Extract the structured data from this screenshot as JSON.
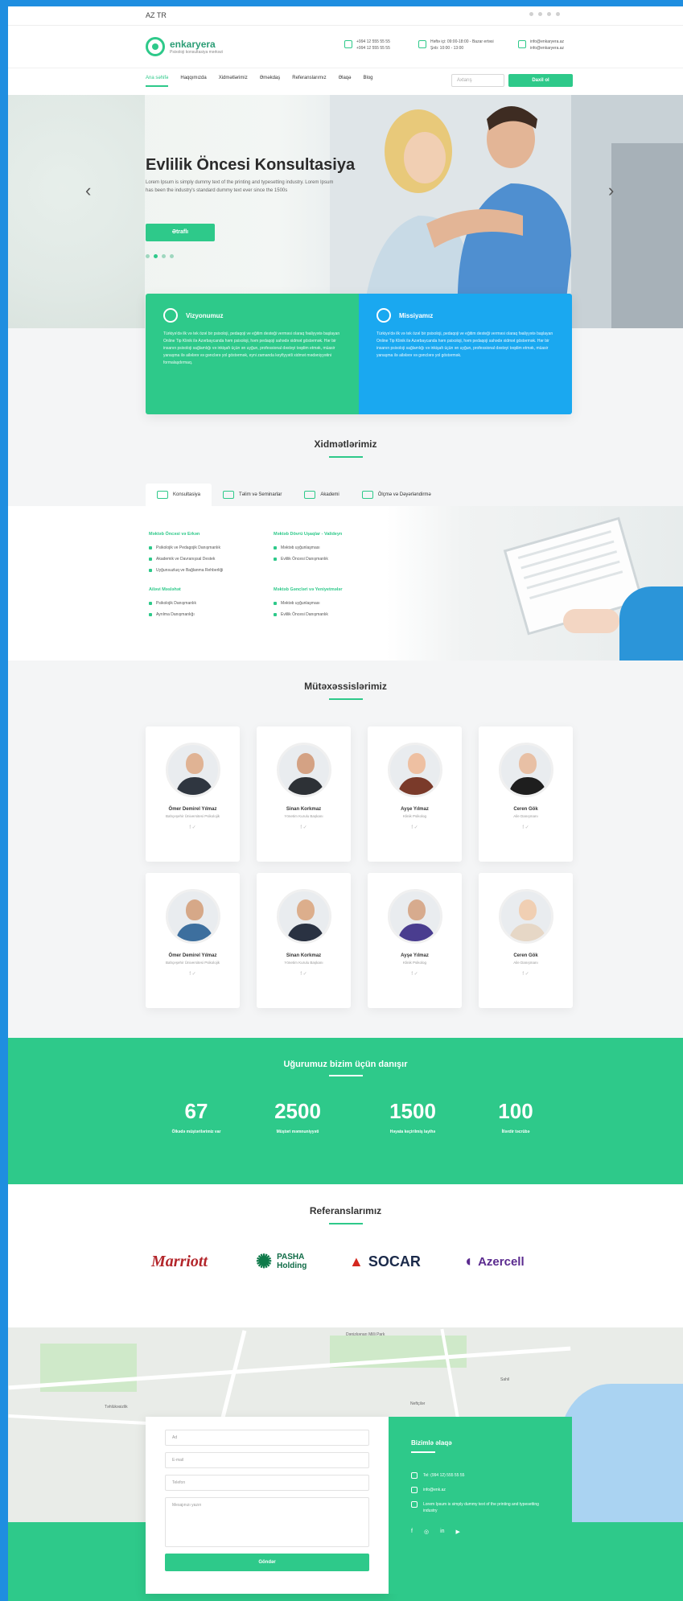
{
  "topbar": {
    "lang": "AZ  TR"
  },
  "header": {
    "logo_name": "enkaryera",
    "logo_tagline": "Psixoloji konsultasiya mərkəzi",
    "phones": [
      "+994 12 555 55 55",
      "+994 12 555 55 55"
    ],
    "hours": [
      "Həftə içi: 09:00-18:00 - Bazar ertəsi",
      "Şnb: 10:00 - 13:00"
    ],
    "emails": [
      "info@enkaryera.az",
      "info@enkaryera.az"
    ]
  },
  "nav": {
    "items": [
      "Ana səhifə",
      "Haqqımızda",
      "Xidmətlərimiz",
      "Əməkdaş",
      "Referanslarımız",
      "Əlaqə",
      "Blog"
    ],
    "search_placeholder": "Axtarış",
    "signin_label": "Daxil ol"
  },
  "hero": {
    "title": "Evlilik Öncesi Konsultasiya",
    "lead": "Lorem Ipsum is simply dummy text of the printing and typesetting industry. Lorem Ipsum has been the industry's standard dummy text ever since the 1500s",
    "button": "Ətraflı",
    "prev_icon": "‹",
    "next_icon": "›"
  },
  "vision": {
    "title": "Vizyonumuz",
    "text": "Türkiyə'də ilk və tek özəl bir psixoloji, pedaqoji ve eğitim desteği verməsi olaraq fəaliyyətə başlayan Online Tip Klinik ilə Azərbaycanda həm psixoloji, həm pedaqoji sahədə xidmət göstərmək. Hər bir insanın psixoloji sağlamlığı və inkişafı üçün ən uyğun, professional dəstəyi təqdim etmək, müasir yanaşma ilə ailələrə və gənclərə yol göstərmək, eyni zamanda keyfiyyətli xidmət mədəniyyətini formalaşdırmaq."
  },
  "mission": {
    "title": "Missiyamız",
    "text": "Türkiyə'də ilk və tek özəl bir psixoloji, pedaqoji ve eğitim desteği verməsi olaraq fəaliyyətə başlayan Online Tip Klinik ilə Azərbaycanda həm psixoloji, həm pedaqoji sahədə xidmət göstərmək. Hər bir insanın psixoloji sağlamlığı və inkişafı üçün ən uyğun, professional dəstəyi təqdim etmək, müasir yanaşma ilə ailələrə və gənclərə yol göstərmək."
  },
  "services": {
    "title": "Xidmətlərimiz",
    "tabs": [
      "Konsultasiya",
      "Təlim və Seminarlar",
      "Akademi",
      "Ölçmə və Dəyərləndirmə"
    ],
    "col1": [
      {
        "heading": "Məktəb Öncəsi və Erkən",
        "items": [
          "Psikolojik ve Pedagojik Danışmanlık",
          "Akademik ve Davranışsal Destek",
          "Uyğunsuzluq ve Bağlanma Rehberliği"
        ]
      },
      {
        "heading": "Ailəvi Məsləhət",
        "items": [
          "Psikolojik Danışmanlık",
          "Ayrılma Danışmanlığı"
        ]
      }
    ],
    "col2": [
      {
        "heading": "Məktəb Dövrü Uşaqlar - Valideyn",
        "items": [
          "Məktəb uyğunlaşması",
          "Evlilik Öncesi Danışmanlık"
        ]
      },
      {
        "heading": "Məktəb Gəncləri və Yeniyetmələr",
        "items": [
          "Məktəb uyğunlaşması",
          "Evlilik Öncesi Danışmanlık"
        ]
      }
    ]
  },
  "experts": {
    "title": "Mütəxəssislərimiz",
    "people": [
      {
        "name": "Ömer Demirel Yılmaz",
        "role": "Bahçeşehir Üniversitesi Psikolojik"
      },
      {
        "name": "Sinan Korkmaz",
        "role": "Yönetim Kurulu Başkanı"
      },
      {
        "name": "Ayşe Yılmaz",
        "role": "Klinik Psikolog"
      },
      {
        "name": "Ceren Gök",
        "role": "Aile Danışmanı"
      },
      {
        "name": "Ömer Demirel Yılmaz",
        "role": "Bahçeşehir Üniversitesi Psikolojik"
      },
      {
        "name": "Sinan Korkmaz",
        "role": "Yönetim Kurulu Başkanı"
      },
      {
        "name": "Ayşe Yılmaz",
        "role": "Klinik Psikolog"
      },
      {
        "name": "Ceren Gök",
        "role": "Aile Danışmanı"
      }
    ]
  },
  "stats": {
    "title": "Uğurumuz bizim üçün danışır",
    "items": [
      {
        "num": "67",
        "label": "Ölkədə müştərilərimiz var"
      },
      {
        "num": "2500",
        "label": "Müştəri məmnuniyyəti"
      },
      {
        "num": "1500",
        "label": "Həyata keçirilmiş layihə"
      },
      {
        "num": "100",
        "label": "İllərdir təcrübə"
      }
    ]
  },
  "references": {
    "title": "Referanslarımız",
    "logos": [
      "Marriott",
      "PASHA Holding",
      "SOCAR",
      "Azercell"
    ]
  },
  "map": {
    "labels": [
      "Dənizkənarı Milli Park",
      "Təhlükəsizlik",
      "Neftçilər",
      "Sahil"
    ]
  },
  "contact_form": {
    "name_placeholder": "Ad",
    "email_placeholder": "E-mail",
    "phone_placeholder": "Telefon",
    "message_placeholder": "Mesajınızı yazın",
    "send_label": "Göndər"
  },
  "contact": {
    "title": "Bizimlə əlaqə",
    "phone": "Tel: (994 12) 555 55 55",
    "email": "info@enk.az",
    "address": "Lorem Ipsum is simply dummy text of the printing and typesetting industry",
    "socials": [
      "f",
      "◎",
      "in",
      "▶"
    ]
  },
  "colors": {
    "accent": "#2ec98a",
    "blue": "#1aa8f0"
  }
}
